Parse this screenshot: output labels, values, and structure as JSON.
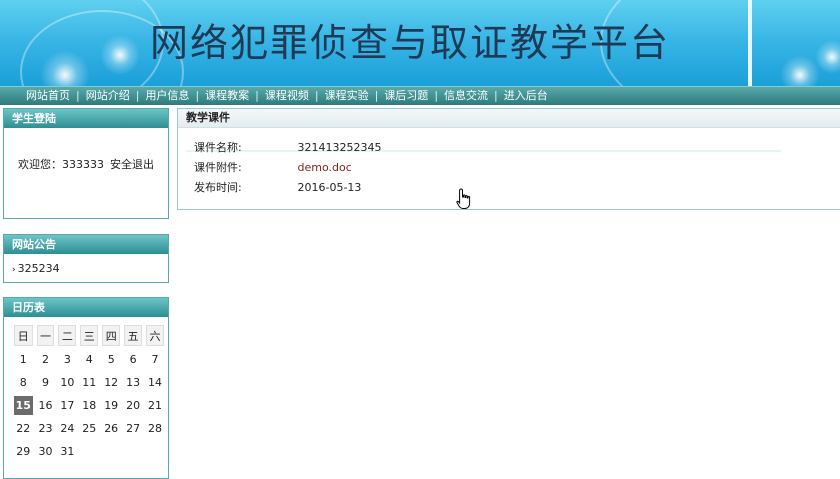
{
  "banner": {
    "title": "网络犯罪侦查与取证教学平台"
  },
  "nav": {
    "items": [
      "网站首页",
      "网站介绍",
      "用户信息",
      "课程教案",
      "课程视频",
      "课程实验",
      "课后习题",
      "信息交流",
      "进入后台"
    ]
  },
  "login": {
    "title": "学生登陆",
    "welcome": "欢迎您：333333",
    "logout": "安全退出"
  },
  "notice": {
    "title": "网站公告",
    "items": [
      "325234"
    ]
  },
  "calendar": {
    "title": "日历表",
    "weekdays": [
      "日",
      "一",
      "二",
      "三",
      "四",
      "五",
      "六"
    ],
    "weeks": [
      [
        "1",
        "2",
        "3",
        "4",
        "5",
        "6",
        "7"
      ],
      [
        "8",
        "9",
        "10",
        "11",
        "12",
        "13",
        "14"
      ],
      [
        "15",
        "16",
        "17",
        "18",
        "19",
        "20",
        "21"
      ],
      [
        "22",
        "23",
        "24",
        "25",
        "26",
        "27",
        "28"
      ],
      [
        "29",
        "30",
        "31",
        "",
        "",
        "",
        ""
      ]
    ],
    "today": "15"
  },
  "courseware": {
    "title": "教学课件",
    "fields": [
      {
        "label": "课件名称:",
        "value": "321413252345"
      },
      {
        "label": "课件附件:",
        "value": "demo.doc"
      },
      {
        "label": "发布时间:",
        "value": "2016-05-13"
      }
    ]
  },
  "colors": {
    "nav_bg": "#2c7c7e",
    "panel_head": "#2c8f94",
    "link": "#8a1f14",
    "banner": "#3ab6e6"
  },
  "icons": {
    "cursor": "hand-pointer-icon"
  }
}
